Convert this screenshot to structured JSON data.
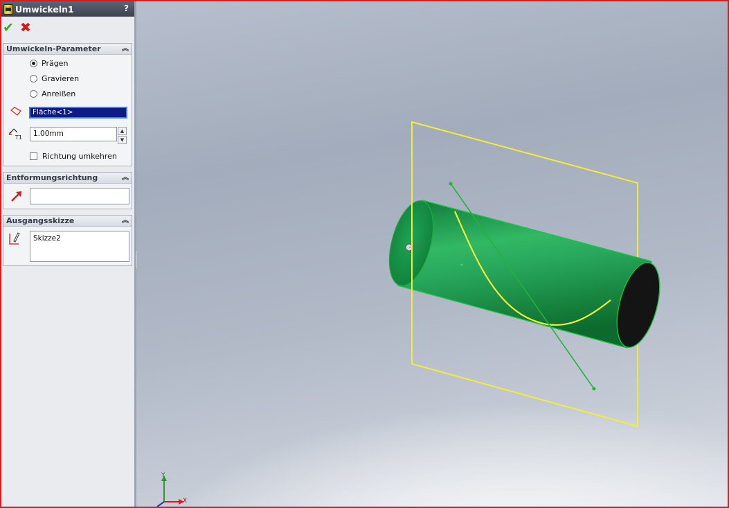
{
  "property_manager": {
    "title": "Umwickeln1",
    "help": "?",
    "ok_glyph": "✔",
    "cancel_glyph": "✖",
    "groups": {
      "parameters": {
        "title": "Umwickeln-Parameter",
        "options": [
          {
            "label": "Prägen",
            "selected": true
          },
          {
            "label": "Gravieren",
            "selected": false
          },
          {
            "label": "Anreißen",
            "selected": false
          }
        ],
        "face_selection": "Fläche<1>",
        "depth_value": "1.00mm",
        "reverse_direction_label": "Richtung umkehren",
        "reverse_direction_checked": false
      },
      "pull_direction": {
        "title": "Entformungsrichtung",
        "value": ""
      },
      "source_sketch": {
        "title": "Ausgangsskizze",
        "value": "Skizze2"
      }
    }
  },
  "viewport": {
    "cylinder_color": "#1f9a4a",
    "plane_color": "#f3ee33",
    "axis_line_color": "#21b43a",
    "triad": {
      "x_label": "X",
      "y_label": "Y"
    }
  },
  "colors": {
    "frame": "#e01818",
    "selection_bg": "#0e1a86",
    "accent_green": "#3aa32a",
    "cancel_red": "#d41919"
  }
}
